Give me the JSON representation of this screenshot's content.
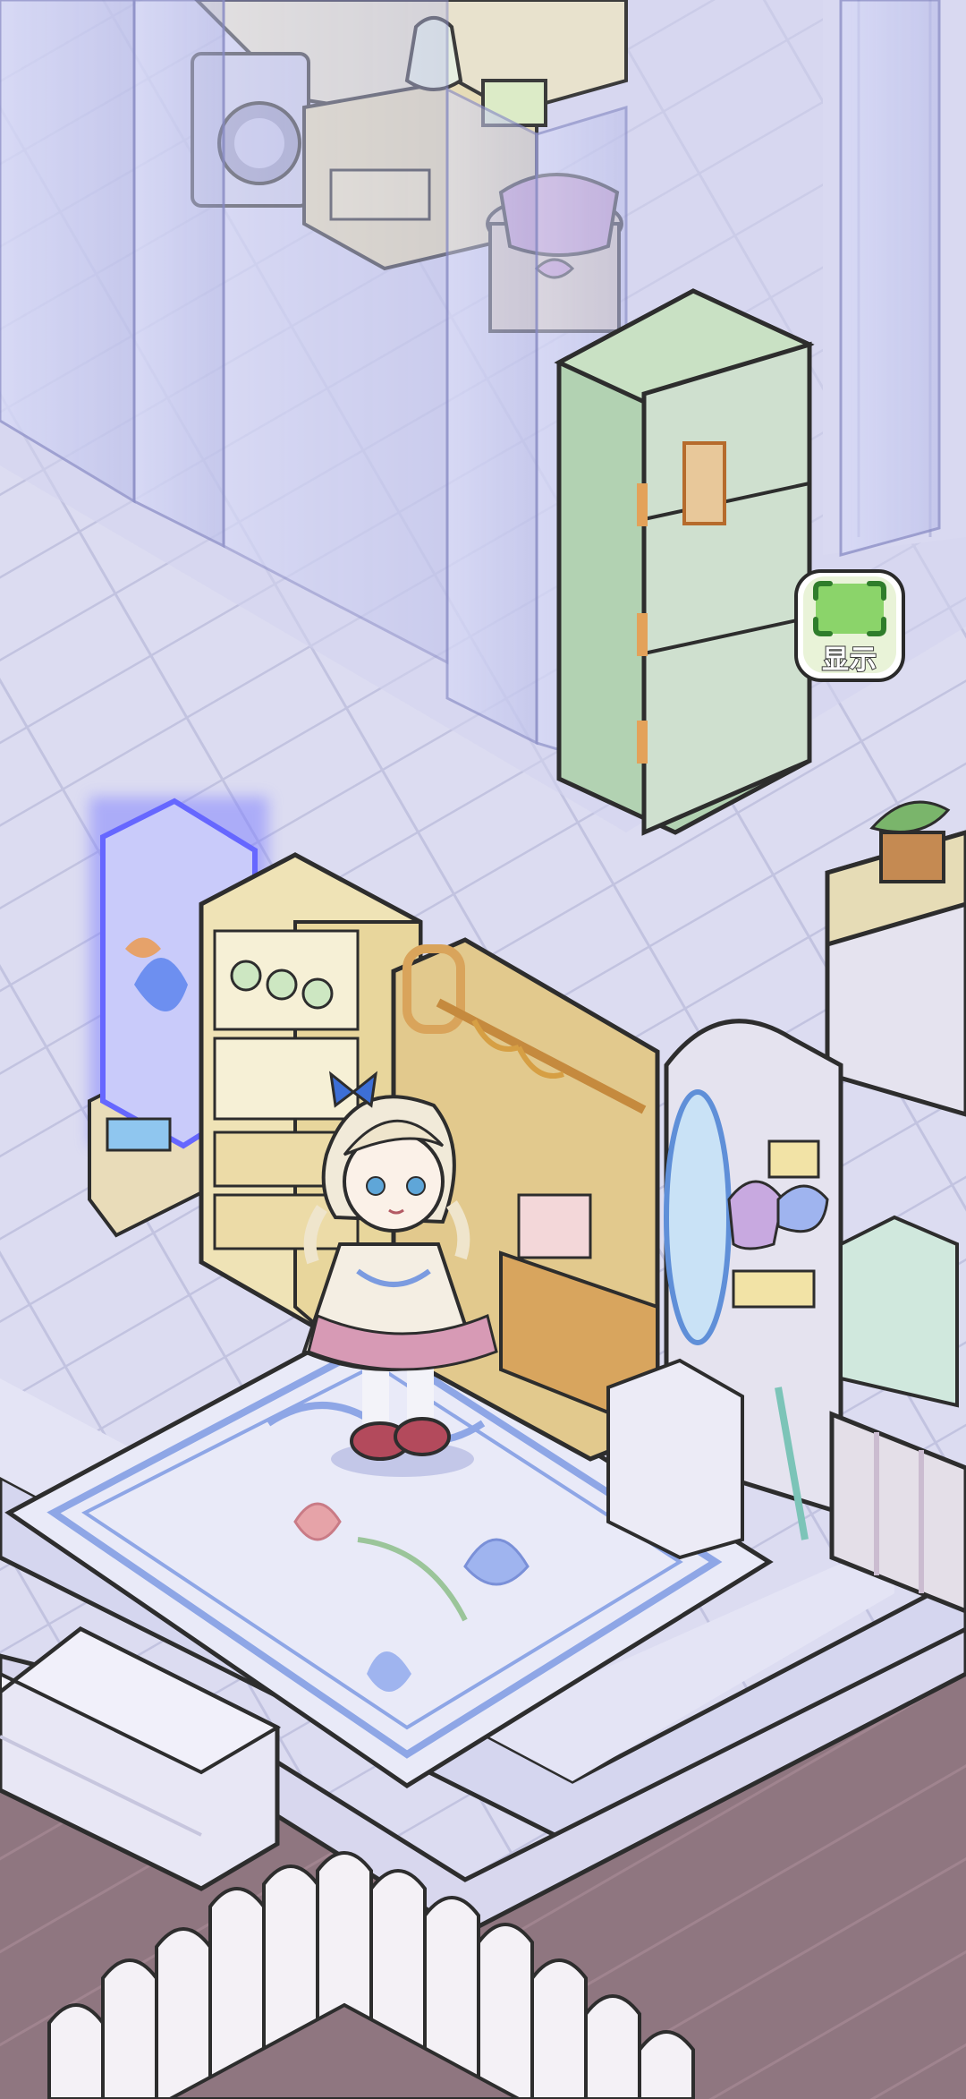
{
  "scene": {
    "name": "room-interior",
    "style": "isometric-cozy-room"
  },
  "controls": {
    "show_toggle": {
      "label": "显示",
      "icon": "focus-frame-icon",
      "color": "#8bd46a"
    }
  },
  "colors": {
    "floor": "#dedff2",
    "wood_floor": "#8b7480",
    "fridge": "#9fc6a2",
    "glass": "#c9cdf4",
    "lamp_glow": "#6a6cff"
  }
}
